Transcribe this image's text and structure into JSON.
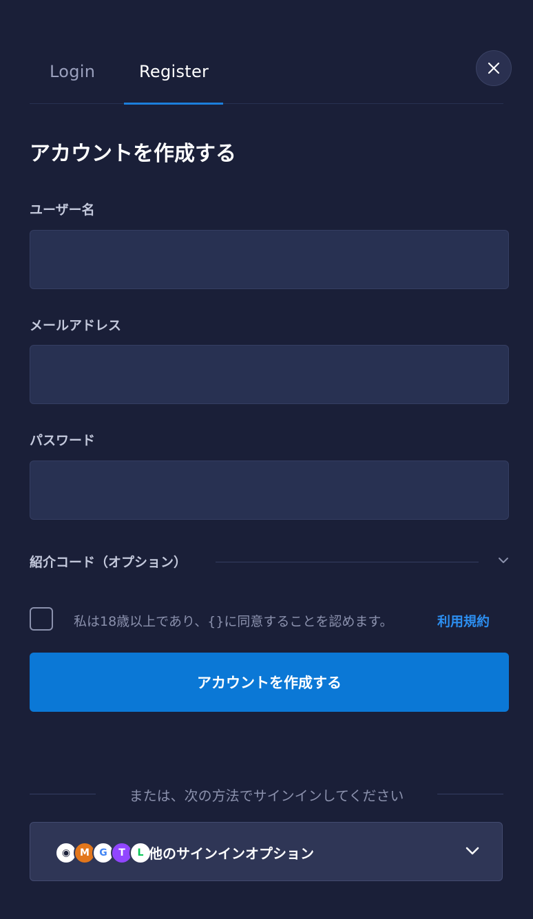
{
  "tabs": {
    "login": "Login",
    "register": "Register"
  },
  "form": {
    "title": "アカウントを作成する",
    "username_label": "ユーザー名",
    "username_value": "",
    "email_label": "メールアドレス",
    "email_value": "",
    "password_label": "パスワード",
    "password_value": "",
    "referral_label": "紹介コード（オプション）",
    "consent_text": "私は18歳以上であり、{}に同意することを認めます。",
    "terms_link": "利用規約",
    "submit_label": "アカウントを作成する"
  },
  "alt_signin": {
    "divider_text": "または、次の方法でサインインしてください",
    "button_label": "他のサインインオプション",
    "providers": [
      {
        "icon": "steam-icon",
        "color": "#ffffff",
        "glyph": "◉"
      },
      {
        "icon": "metamask-icon",
        "color": "#e2761b",
        "glyph": "M"
      },
      {
        "icon": "google-icon",
        "color": "#34a853",
        "glyph": "G"
      },
      {
        "icon": "twitch-icon",
        "color": "#9146ff",
        "glyph": "T"
      },
      {
        "icon": "line-icon",
        "color": "#ffffff",
        "glyph": "L"
      }
    ]
  },
  "colors": {
    "background": "#1a1f38",
    "accent": "#0b78d6",
    "link": "#2c8ef0",
    "input_bg": "#283152"
  }
}
